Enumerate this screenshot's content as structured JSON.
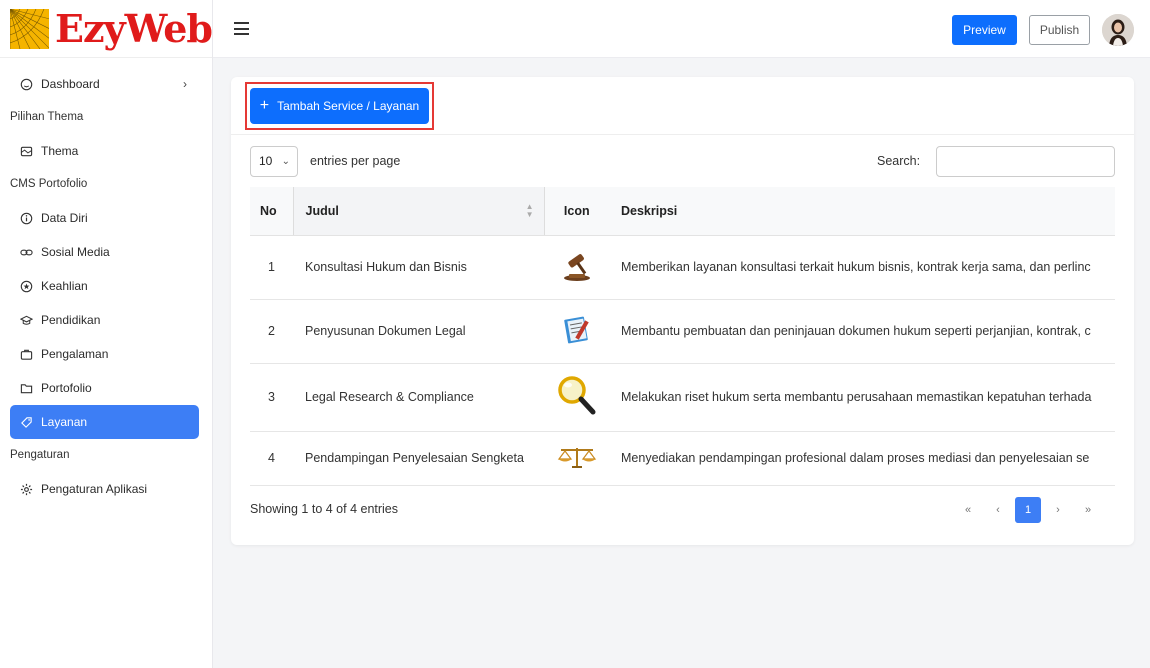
{
  "brand": {
    "logo_text": "EzyWeb",
    "logo_color": "#e01b1b",
    "mark_color": "#f5b400"
  },
  "sidebar": {
    "dashboard": {
      "label": "Dashboard",
      "icon": "dashboard-icon"
    },
    "sections": [
      {
        "title": "Pilihan Thema"
      },
      {
        "title": "CMS Portofolio"
      },
      {
        "title": "Pengaturan"
      }
    ],
    "items": [
      {
        "label": "Thema",
        "icon": "theme-icon"
      },
      {
        "label": "Data Diri",
        "icon": "info-icon"
      },
      {
        "label": "Sosial Media",
        "icon": "link-icon"
      },
      {
        "label": "Keahlian",
        "icon": "star-circle-icon"
      },
      {
        "label": "Pendidikan",
        "icon": "graduation-cap-icon"
      },
      {
        "label": "Pengalaman",
        "icon": "briefcase-icon"
      },
      {
        "label": "Portofolio",
        "icon": "folder-icon"
      },
      {
        "label": "Layanan",
        "icon": "tag-icon",
        "active": true
      },
      {
        "label": "Pengaturan Aplikasi",
        "icon": "gear-icon"
      }
    ]
  },
  "topbar": {
    "preview_label": "Preview",
    "publish_label": "Publish",
    "accent": "#0d6efd"
  },
  "card": {
    "add_button_label": "Tambah Service / Layanan",
    "page_size": "10",
    "entries_label": "entries per page",
    "search_label": "Search:",
    "search_value": ""
  },
  "table": {
    "headers": {
      "no": "No",
      "judul": "Judul",
      "icon": "Icon",
      "deskripsi": "Deskripsi"
    },
    "rows": [
      {
        "no": "1",
        "judul": "Konsultasi Hukum dan Bisnis",
        "icon": "gavel-icon",
        "deskripsi": "Memberikan layanan konsultasi terkait hukum bisnis, kontrak kerja sama, dan perlinc"
      },
      {
        "no": "2",
        "judul": "Penyusunan Dokumen Legal",
        "icon": "document-pen-icon",
        "deskripsi": "Membantu pembuatan dan peninjauan dokumen hukum seperti perjanjian, kontrak, c"
      },
      {
        "no": "3",
        "judul": "Legal Research & Compliance",
        "icon": "magnifier-icon",
        "deskripsi": "Melakukan riset hukum serta membantu perusahaan memastikan kepatuhan terhada"
      },
      {
        "no": "4",
        "judul": "Pendampingan Penyelesaian Sengketa",
        "icon": "scales-icon",
        "deskripsi": "Menyediakan pendampingan profesional dalam proses mediasi dan penyelesaian se"
      }
    ]
  },
  "footer": {
    "info": "Showing 1 to 4 of 4 entries",
    "pager": {
      "first": "«",
      "prev": "‹",
      "current": "1",
      "next": "›",
      "last": "»"
    }
  }
}
